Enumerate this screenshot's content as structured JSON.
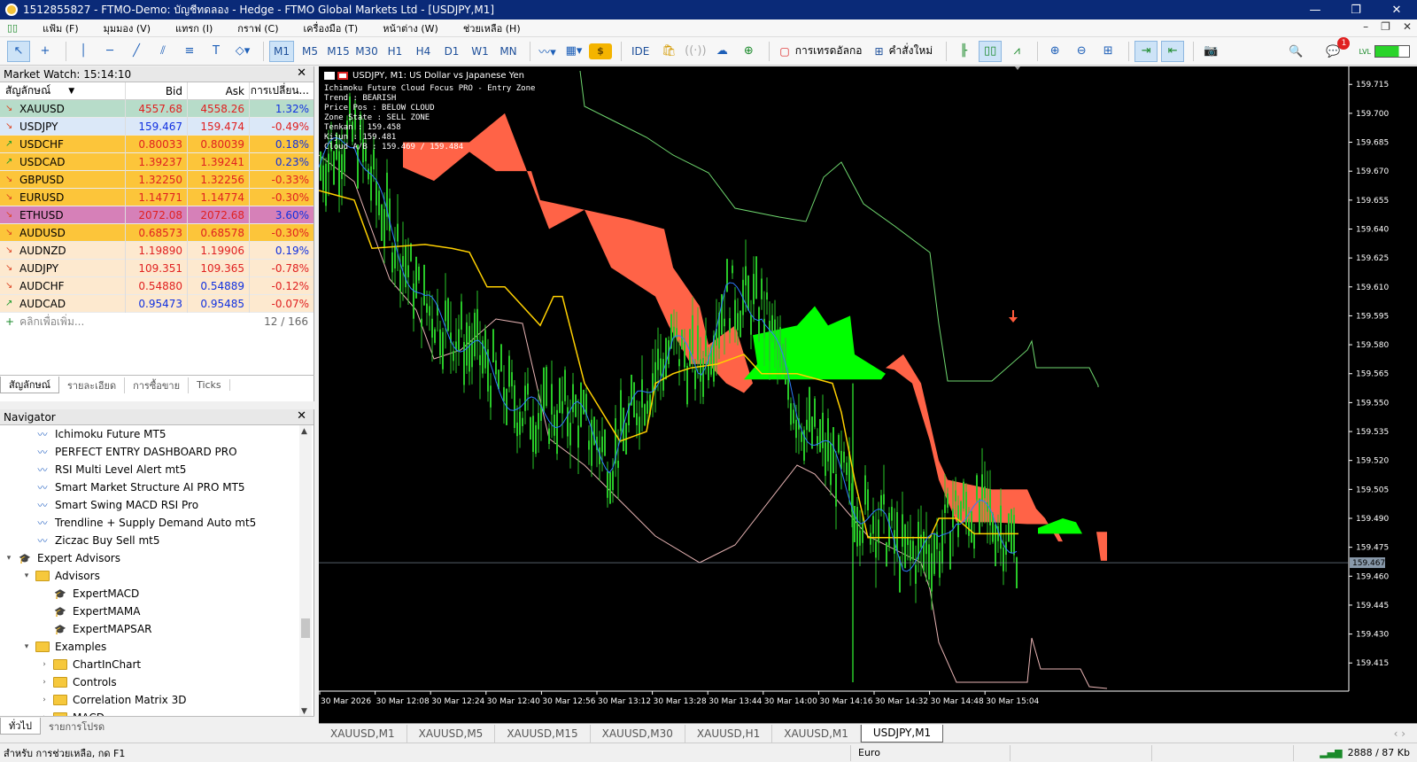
{
  "window": {
    "title": "1512855827 - FTMO-Demo: บัญชีทดลอง - Hedge - FTMO Global Markets Ltd - [USDJPY,M1]",
    "controls": [
      "—",
      "❐",
      "✕"
    ]
  },
  "menu": {
    "items": [
      "แฟ้ม (F)",
      "มุมมอง (V)",
      "แทรก (I)",
      "กราฟ (C)",
      "เครื่องมือ (T)",
      "หน้าต่าง (W)",
      "ช่วยเหลือ (H)"
    ],
    "right_controls": [
      "–",
      "❐",
      "✕"
    ]
  },
  "toolbar": {
    "timeframes": [
      "M1",
      "M5",
      "M15",
      "M30",
      "H1",
      "H4",
      "D1",
      "W1",
      "MN"
    ],
    "selected_timeframe": "M1",
    "ide_label": "IDE",
    "algo_trading_label": "การเทรดอัลกอ",
    "new_order_label": "คำสั่งใหม่",
    "notification_count": "1",
    "signal_label": "LVL"
  },
  "market_watch": {
    "title": "Market Watch: 15:14:10",
    "columns": [
      "สัญลักษณ์",
      "Bid",
      "Ask",
      "การเปลี่ยน..."
    ],
    "rows": [
      {
        "symbol": "XAUUSD",
        "bid": "4557.68",
        "ask": "4558.26",
        "change": "1.32%",
        "dir": "dn",
        "bg": "#b7dcc9",
        "bid_color": "#e02020",
        "ask_color": "#e02020",
        "chg_color": "#1030e0"
      },
      {
        "symbol": "USDJPY",
        "bid": "159.467",
        "ask": "159.474",
        "change": "-0.49%",
        "dir": "dn",
        "bg": "#dbe8f8",
        "bid_color": "#1030e0",
        "ask_color": "#e02020",
        "chg_color": "#e02020"
      },
      {
        "symbol": "USDCHF",
        "bid": "0.80033",
        "ask": "0.80039",
        "change": "0.18%",
        "dir": "up",
        "bg": "#fcc53a",
        "bid_color": "#e02020",
        "ask_color": "#e02020",
        "chg_color": "#1030e0"
      },
      {
        "symbol": "USDCAD",
        "bid": "1.39237",
        "ask": "1.39241",
        "change": "0.23%",
        "dir": "up",
        "bg": "#fcc53a",
        "bid_color": "#e02020",
        "ask_color": "#e02020",
        "chg_color": "#1030e0"
      },
      {
        "symbol": "GBPUSD",
        "bid": "1.32250",
        "ask": "1.32256",
        "change": "-0.33%",
        "dir": "dn",
        "bg": "#fcc53a",
        "bid_color": "#e02020",
        "ask_color": "#e02020",
        "chg_color": "#e02020"
      },
      {
        "symbol": "EURUSD",
        "bid": "1.14771",
        "ask": "1.14774",
        "change": "-0.30%",
        "dir": "dn",
        "bg": "#fcc53a",
        "bid_color": "#e02020",
        "ask_color": "#e02020",
        "chg_color": "#e02020"
      },
      {
        "symbol": "ETHUSD",
        "bid": "2072.08",
        "ask": "2072.68",
        "change": "3.60%",
        "dir": "dn",
        "bg": "#d680b8",
        "bid_color": "#e02020",
        "ask_color": "#e02020",
        "chg_color": "#1030e0"
      },
      {
        "symbol": "AUDUSD",
        "bid": "0.68573",
        "ask": "0.68578",
        "change": "-0.30%",
        "dir": "dn",
        "bg": "#fcc53a",
        "bid_color": "#e02020",
        "ask_color": "#e02020",
        "chg_color": "#e02020"
      },
      {
        "symbol": "AUDNZD",
        "bid": "1.19890",
        "ask": "1.19906",
        "change": "0.19%",
        "dir": "dn",
        "bg": "#fde9cf",
        "bid_color": "#e02020",
        "ask_color": "#e02020",
        "chg_color": "#1030e0"
      },
      {
        "symbol": "AUDJPY",
        "bid": "109.351",
        "ask": "109.365",
        "change": "-0.78%",
        "dir": "dn",
        "bg": "#fde9cf",
        "bid_color": "#e02020",
        "ask_color": "#e02020",
        "chg_color": "#e02020"
      },
      {
        "symbol": "AUDCHF",
        "bid": "0.54880",
        "ask": "0.54889",
        "change": "-0.12%",
        "dir": "dn",
        "bg": "#fde9cf",
        "bid_color": "#e02020",
        "ask_color": "#1030e0",
        "chg_color": "#e02020"
      },
      {
        "symbol": "AUDCAD",
        "bid": "0.95473",
        "ask": "0.95485",
        "change": "-0.07%",
        "dir": "up",
        "bg": "#fde9cf",
        "bid_color": "#1030e0",
        "ask_color": "#1030e0",
        "chg_color": "#e02020"
      }
    ],
    "add_label": "คลิกเพื่อเพิ่ม...",
    "count": "12 / 166",
    "tabs": [
      "สัญลักษณ์",
      "รายละเอียด",
      "การซื้อขาย",
      "Ticks"
    ]
  },
  "navigator": {
    "title": "Navigator",
    "items": [
      {
        "label": "Ichimoku Future MT5",
        "type": "ind",
        "indent": 40
      },
      {
        "label": "PERFECT ENTRY DASHBOARD PRO",
        "type": "ind",
        "indent": 40
      },
      {
        "label": "RSI Multi Level Alert mt5",
        "type": "ind",
        "indent": 40
      },
      {
        "label": "Smart Market Structure AI PRO MT5",
        "type": "ind",
        "indent": 40
      },
      {
        "label": "Smart Swing MACD RSI Pro",
        "type": "ind",
        "indent": 40
      },
      {
        "label": "Trendline + Supply Demand Auto mt5",
        "type": "ind",
        "indent": 40
      },
      {
        "label": "Ziczac Buy Sell mt5",
        "type": "ind",
        "indent": 40
      },
      {
        "label": "Expert Advisors",
        "type": "ea",
        "indent": 4,
        "tw": "▾"
      },
      {
        "label": "Advisors",
        "type": "folder",
        "indent": 24,
        "tw": "▾"
      },
      {
        "label": "ExpertMACD",
        "type": "ea",
        "indent": 60
      },
      {
        "label": "ExpertMAMA",
        "type": "ea",
        "indent": 60
      },
      {
        "label": "ExpertMAPSAR",
        "type": "ea",
        "indent": 60
      },
      {
        "label": "Examples",
        "type": "folder",
        "indent": 24,
        "tw": "▾"
      },
      {
        "label": "ChartInChart",
        "type": "folder",
        "indent": 44,
        "tw": "›"
      },
      {
        "label": "Controls",
        "type": "folder",
        "indent": 44,
        "tw": "›"
      },
      {
        "label": "Correlation Matrix 3D",
        "type": "folder",
        "indent": 44,
        "tw": "›"
      },
      {
        "label": "MACD",
        "type": "folder",
        "indent": 44,
        "tw": "›"
      }
    ],
    "tabs": [
      "ทั่วไป",
      "รายการโปรด"
    ]
  },
  "chart": {
    "title": "USDJPY, M1:  US Dollar vs Japanese Yen",
    "info_lines": [
      "Ichimoku Future Cloud Focus PRO - Entry Zone",
      "Trend      : BEARISH",
      "Price Pos  : BELOW CLOUD",
      "Zone State : SELL ZONE",
      "Tenkan     : 159.458",
      "Kijun      : 159.481",
      "Cloud A/B  : 159.469 / 159.484"
    ],
    "current_price": "159.467",
    "price_labels": [
      "159.715",
      "159.700",
      "159.685",
      "159.670",
      "159.655",
      "159.640",
      "159.625",
      "159.610",
      "159.595",
      "159.580",
      "159.565",
      "159.550",
      "159.535",
      "159.520",
      "159.505",
      "159.490",
      "159.475",
      "159.460",
      "159.445",
      "159.430",
      "159.415"
    ],
    "time_labels": [
      "30 Mar 2026",
      "30 Mar 12:08",
      "30 Mar 12:24",
      "30 Mar 12:40",
      "30 Mar 12:56",
      "30 Mar 13:12",
      "30 Mar 13:28",
      "30 Mar 13:44",
      "30 Mar 14:00",
      "30 Mar 14:16",
      "30 Mar 14:32",
      "30 Mar 14:48",
      "30 Mar 15:04"
    ],
    "colors": {
      "bull": "#28c828",
      "cloud_bear": "#ff6347",
      "cloud_bull": "#00ff00",
      "tenkan": "#2f7dff",
      "kijun": "#ffd000",
      "envelope_up": "#6fd86f",
      "envelope_dn": "#e8b4b4"
    }
  },
  "chart_tabs": {
    "items": [
      "XAUUSD,M1",
      "XAUUSD,M5",
      "XAUUSD,M15",
      "XAUUSD,M30",
      "XAUUSD,H1",
      "XAUUSD,M1",
      "USDJPY,M1"
    ],
    "active": "USDJPY,M1"
  },
  "status": {
    "help": "สำหรับ การช่วยเหลือ, กด F1",
    "profile": "Euro",
    "traffic": "2888 / 87 Kb"
  }
}
